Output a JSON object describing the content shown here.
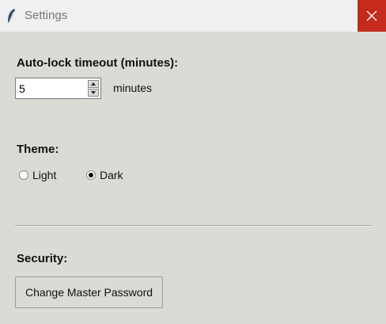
{
  "window": {
    "title": "Settings",
    "close_icon": "close-icon",
    "app_icon": "feather-icon"
  },
  "autolock": {
    "heading": "Auto-lock timeout (minutes):",
    "value": "5",
    "unit_label": "minutes"
  },
  "theme": {
    "heading": "Theme:",
    "options": [
      {
        "label": "Light",
        "selected": false
      },
      {
        "label": "Dark",
        "selected": true
      }
    ]
  },
  "security": {
    "heading": "Security:",
    "change_password_label": "Change Master Password"
  },
  "colors": {
    "window_bg": "#dcdad5",
    "titlebar_bg": "#f0f0f0",
    "close_bg": "#c42b1c"
  }
}
